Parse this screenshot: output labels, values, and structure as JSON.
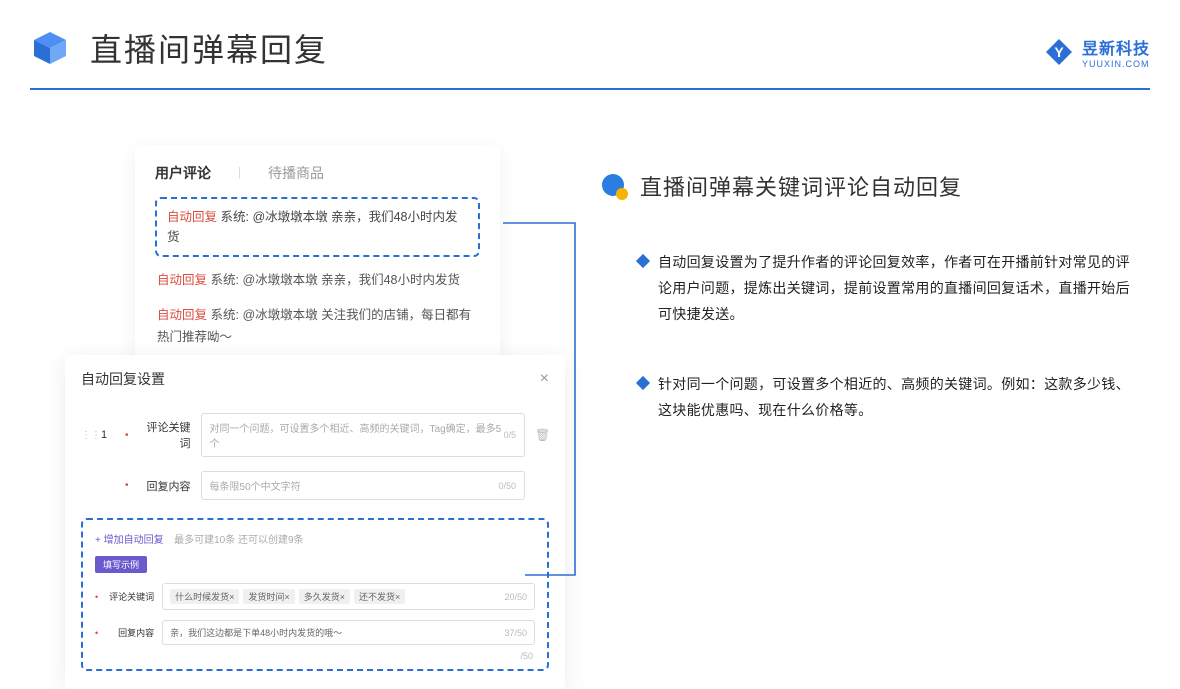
{
  "header": {
    "title": "直播间弹幕回复",
    "brand_main": "昱新科技",
    "brand_sub": "YUUXIN.COM"
  },
  "comments": {
    "tab_active": "用户评论",
    "tab_inactive": "待播商品",
    "highlighted": {
      "tag": "自动回复",
      "text": "系统: @冰墩墩本墩 亲亲，我们48小时内发货"
    },
    "line2": {
      "tag": "自动回复",
      "text": "系统: @冰墩墩本墩 亲亲，我们48小时内发货"
    },
    "line3": {
      "tag": "自动回复",
      "text": "系统: @冰墩墩本墩 关注我们的店铺，每日都有热门推荐呦～"
    }
  },
  "settings": {
    "title": "自动回复设置",
    "row_num": "1",
    "keyword_label": "评论关键词",
    "keyword_ph": "对同一个问题，可设置多个相近、高频的关键词，Tag确定，最多5个",
    "keyword_count": "0/5",
    "content_label": "回复内容",
    "content_ph": "每条限50个中文字符",
    "content_count": "0/50",
    "add_link": "+ 增加自动回复",
    "add_hint": "最多可建10条 还可以创建9条",
    "example_badge": "填写示例",
    "ex_kw_label": "评论关键词",
    "ex_chips": [
      "什么时候发货×",
      "发货时间×",
      "多久发货×",
      "还不发货×"
    ],
    "ex_kw_count": "20/50",
    "ex_content_label": "回复内容",
    "ex_content_val": "亲，我们这边都是下单48小时内发货的哦～",
    "ex_content_count": "37/50",
    "outer_count": "/50"
  },
  "article": {
    "title": "直播间弹幕关键词评论自动回复",
    "bullets": [
      "自动回复设置为了提升作者的评论回复效率，作者可在开播前针对常见的评论用户问题，提炼出关键词，提前设置常用的直播间回复话术，直播开始后可快捷发送。",
      "针对同一个问题，可设置多个相近的、高频的关键词。例如：这款多少钱、这块能优惠吗、现在什么价格等。"
    ]
  }
}
